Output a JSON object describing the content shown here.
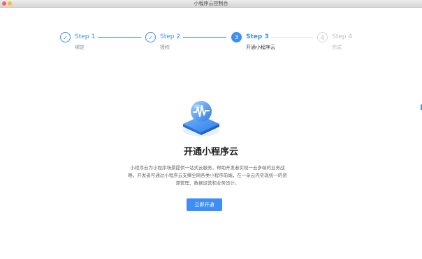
{
  "window": {
    "title": "小程序云控制台"
  },
  "steps": [
    {
      "number": "1",
      "label": "Step 1",
      "sub": "绑定",
      "state": "done"
    },
    {
      "number": "2",
      "label": "Step 2",
      "sub": "授权",
      "state": "done"
    },
    {
      "number": "3",
      "label": "Step 3",
      "sub": "开通小程序云",
      "state": "active"
    },
    {
      "number": "4",
      "label": "Step 4",
      "sub": "完成",
      "state": "todo"
    }
  ],
  "hero": {
    "icon": "cloud-waveform-illustration"
  },
  "main": {
    "title": "开通小程序云",
    "desc_line1": "小程序云为小程序场景提供一站式云服务，帮助开发者实现一云多端的业务战",
    "desc_line2": "略。开发者可通过小程序云支撑全网各类小程序前端，在一朵云内实现统一的资",
    "desc_line3": "源管理、数据运营和业务设计。",
    "cta_label": "立即开通"
  },
  "colors": {
    "accent": "#3d8ef5",
    "todo": "#bdbdbd"
  }
}
